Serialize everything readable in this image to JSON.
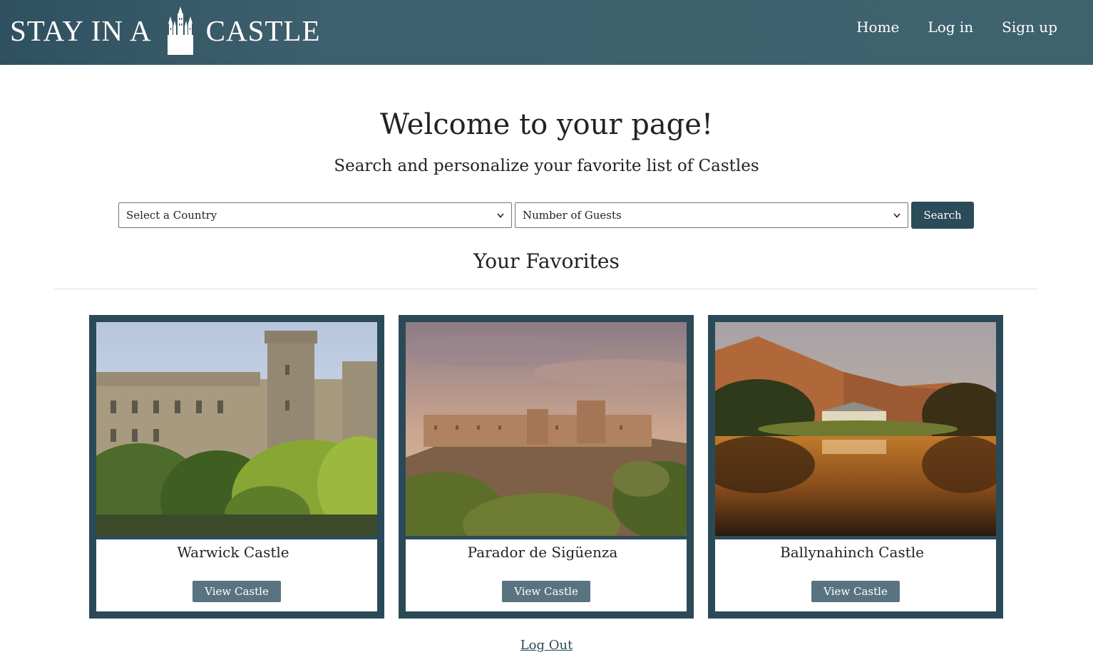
{
  "brand": {
    "part1": "STAY IN A",
    "part2": "CASTLE",
    "icon": "castle-icon"
  },
  "nav": {
    "links": [
      {
        "label": "Home"
      },
      {
        "label": "Log in"
      },
      {
        "label": "Sign up"
      }
    ]
  },
  "main": {
    "title": "Welcome to your page!",
    "subtitle": "Search and personalize your favorite list of Castles"
  },
  "search": {
    "country_selected": "Select a Country",
    "guests_selected": "Number of Guests",
    "button_label": "Search"
  },
  "favorites": {
    "heading": "Your Favorites",
    "cards": [
      {
        "name": "Warwick Castle",
        "button_label": "View Castle"
      },
      {
        "name": "Parador de Sigüenza",
        "button_label": "View Castle"
      },
      {
        "name": "Ballynahinch Castle",
        "button_label": "View Castle"
      }
    ]
  },
  "footer": {
    "logout_label": "Log Out"
  },
  "colors": {
    "header": "#3f626f",
    "accent": "#2b4a58",
    "button_secondary": "#5a7380"
  }
}
